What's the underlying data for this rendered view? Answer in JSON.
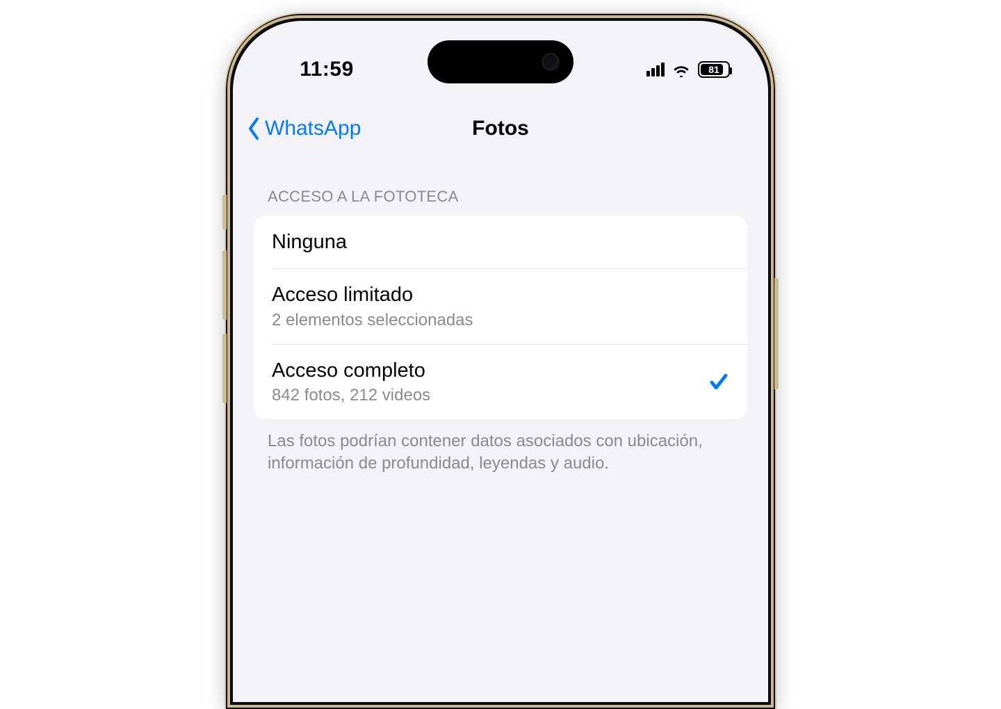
{
  "status": {
    "time": "11:59",
    "battery_pct": 81,
    "battery_label": "81"
  },
  "nav": {
    "back_label": "WhatsApp",
    "title": "Fotos"
  },
  "section": {
    "header": "ACCESO A LA FOTOTECA",
    "footer": "Las fotos podrían contener datos asociados con ubicación, información de profundidad, leyendas y audio."
  },
  "options": {
    "none": {
      "title": "Ninguna",
      "selected": false
    },
    "limited": {
      "title": "Acceso limitado",
      "subtitle": "2 elementos seleccionadas",
      "selected": false
    },
    "full": {
      "title": "Acceso completo",
      "subtitle": "842 fotos, 212 videos",
      "selected": true
    }
  }
}
